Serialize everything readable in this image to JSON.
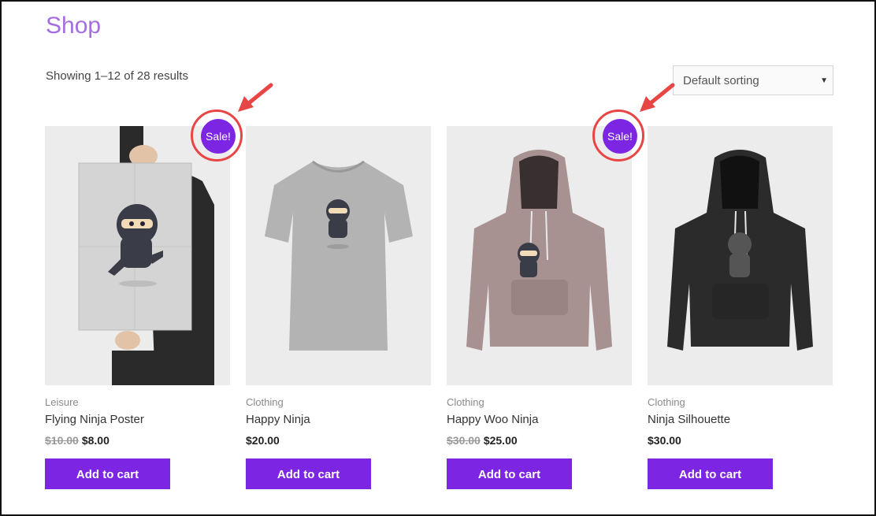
{
  "page": {
    "title": "Shop"
  },
  "toolbar": {
    "result_count": "Showing 1–12 of 28 results",
    "sort_value": "Default sorting",
    "sort_caret": "▼"
  },
  "colors": {
    "accent": "#7c25e2",
    "title": "#a46de0",
    "annotation": "#e84545"
  },
  "products": [
    {
      "category": "Leisure",
      "name": "Flying Ninja Poster",
      "old_price": "$10.00",
      "price": "$8.00",
      "on_sale": true,
      "sale_label": "Sale!",
      "button": "Add to cart",
      "image": "poster-image"
    },
    {
      "category": "Clothing",
      "name": "Happy Ninja",
      "old_price": "",
      "price": "$20.00",
      "on_sale": false,
      "button": "Add to cart",
      "image": "tshirt-image"
    },
    {
      "category": "Clothing",
      "name": "Happy Woo Ninja",
      "old_price": "$30.00",
      "price": "$25.00",
      "on_sale": true,
      "sale_label": "Sale!",
      "button": "Add to cart",
      "image": "hoodie-pink-image"
    },
    {
      "category": "Clothing",
      "name": "Ninja Silhouette",
      "old_price": "",
      "price": "$30.00",
      "on_sale": false,
      "button": "Add to cart",
      "image": "hoodie-black-image"
    }
  ]
}
